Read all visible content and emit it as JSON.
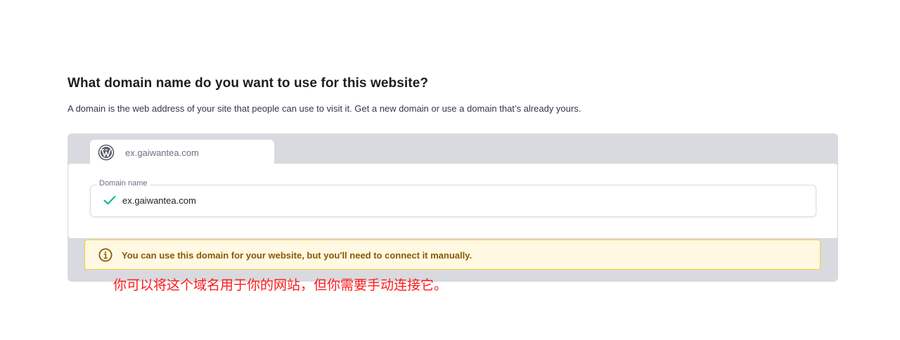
{
  "header": {
    "title": "What domain name do you want to use for this website?",
    "subtitle": "A domain is the web address of your site that people can use to visit it. Get a new domain or use a domain that’s already yours."
  },
  "domain_tab": {
    "icon": "wordpress-icon",
    "label": "ex.gaiwantea.com"
  },
  "domain_field": {
    "label": "Domain name",
    "value": "ex.gaiwantea.com",
    "status_icon": "check-icon",
    "status_color": "#00b090"
  },
  "alert": {
    "icon": "info-icon",
    "message": "You can use this domain for your website, but you'll need to connect it manually.",
    "background": "#fff8e2",
    "border": "#ffcd35",
    "text_color": "#8a5a00"
  },
  "annotation": {
    "text": "你可以将这个域名用于你的网站，但你需要手动连接它。",
    "color": "#ff1a1a"
  }
}
